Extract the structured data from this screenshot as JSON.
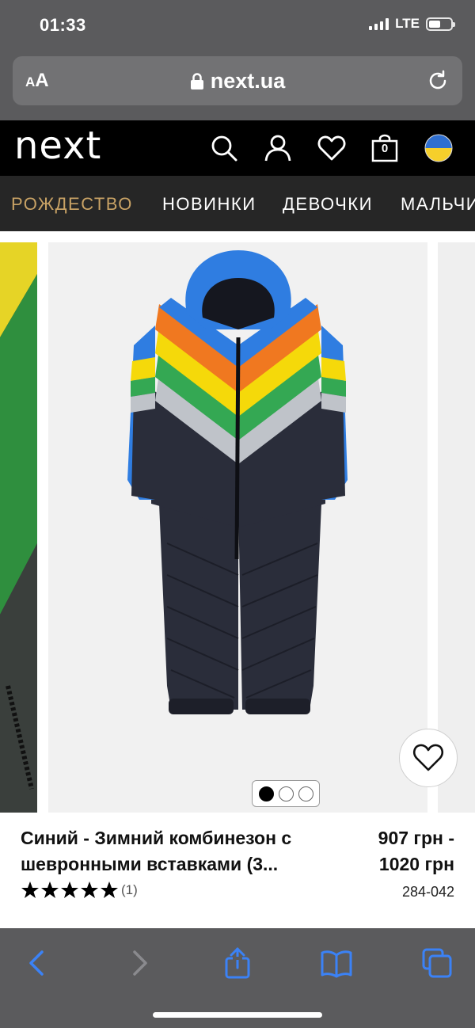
{
  "status_bar": {
    "time": "01:33",
    "network": "LTE",
    "battery_level": 0.55
  },
  "browser": {
    "text_size_label": "AA",
    "url": "next.ua"
  },
  "header": {
    "logo": "next",
    "bag_count": "0",
    "icons": [
      "search-icon",
      "user-icon",
      "heart-icon",
      "bag-icon",
      "ukraine-flag-icon"
    ]
  },
  "nav": {
    "items": [
      {
        "label": "РОЖДЕСТВО",
        "active": true
      },
      {
        "label": "НОВИНКИ",
        "active": false
      },
      {
        "label": "ДЕВОЧКИ",
        "active": false
      },
      {
        "label": "МАЛЬЧИ",
        "active": false
      }
    ]
  },
  "product": {
    "title_line1": "Синий - Зимний комбинезон с",
    "title_line2": "шевронными вставками (3...",
    "price_line1": "907 грн -",
    "price_line2": "1020 грн",
    "rating": 5,
    "reviews": "(1)",
    "sku": "284-042",
    "carousel": {
      "total": 3,
      "active": 1
    }
  },
  "toolbar": {
    "icons": [
      "back-icon",
      "forward-icon",
      "share-icon",
      "bookmarks-icon",
      "tabs-icon"
    ]
  },
  "colors": {
    "accent_nav": "#c8a265",
    "browser_chrome": "#5b5b5d",
    "ios_blue": "#3b82f6"
  }
}
